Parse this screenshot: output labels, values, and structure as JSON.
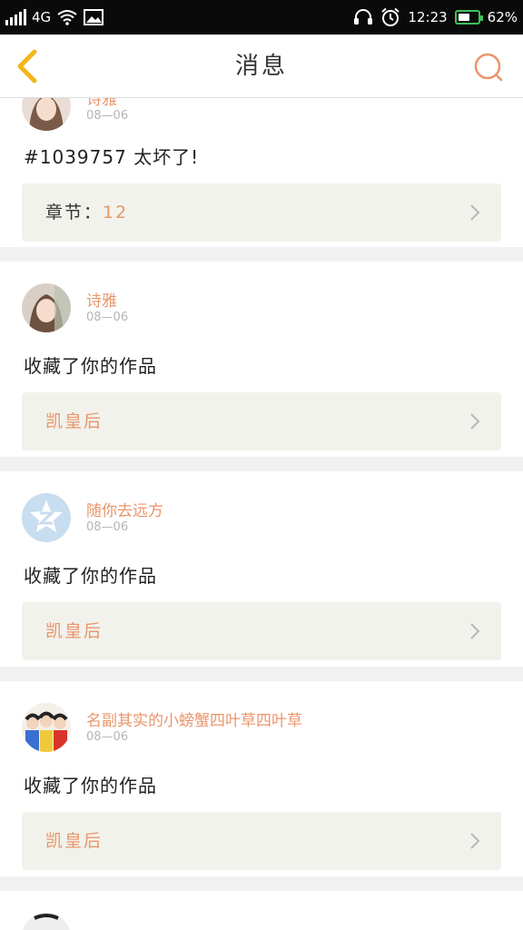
{
  "status_bar": {
    "network": "4G",
    "time": "12:23",
    "battery": "62%",
    "battery_level": 0.62,
    "icons": [
      "signal-icon",
      "wifi-icon",
      "image-icon",
      "headset-icon",
      "alarm-icon",
      "battery-icon"
    ]
  },
  "header": {
    "title": "消息",
    "back_icon": "chevron-left-icon",
    "search_icon": "search-icon"
  },
  "colors": {
    "accent": "#e9966b",
    "back_accent": "#f2b61b",
    "link_box_bg": "#f2f2ec",
    "battery": "#3fc25a"
  },
  "messages": [
    {
      "user": "诗雅",
      "date": "08—06",
      "text": "#1039757 太坏了!",
      "link_key": "章节：",
      "link_value": "12"
    },
    {
      "user": "诗雅",
      "date": "08—06",
      "text": "收藏了你的作品",
      "link": "凯皇后"
    },
    {
      "user": "随你去远方",
      "date": "08—06",
      "text": "收藏了你的作品",
      "link": "凯皇后"
    },
    {
      "user": "名副其实的小螃蟹四叶草四叶草",
      "date": "08—06",
      "text": "收藏了你的作品",
      "link": "凯皇后"
    }
  ]
}
